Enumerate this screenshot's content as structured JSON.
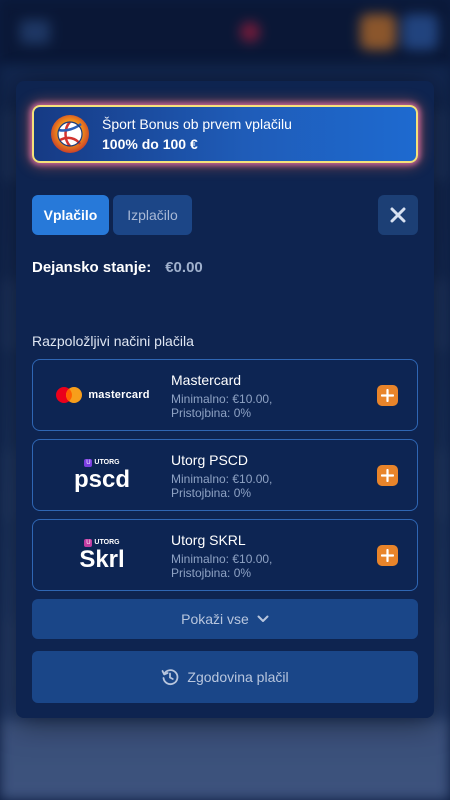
{
  "bonus": {
    "title": "Šport Bonus ob prvem vplačilu",
    "amount": "100% do 100 €",
    "icon": "volleyball-icon"
  },
  "tabs": [
    {
      "label": "Vplačilo",
      "active": true
    },
    {
      "label": "Izplačilo",
      "active": false
    }
  ],
  "close_icon": "close-icon",
  "balance": {
    "label": "Dejansko stanje:",
    "value": "€0.00"
  },
  "methods_title": "Razpoložljivi načini plačila",
  "methods": [
    {
      "name": "Mastercard",
      "min": "Minimalno: €10.00,",
      "fee": "Pristojbina: 0%",
      "logo_text": "mastercard",
      "icon": "mastercard-logo"
    },
    {
      "name": "Utorg PSCD",
      "min": "Minimalno: €10.00,",
      "fee": "Pristojbina: 0%",
      "logo_badge": "UTORG",
      "logo_text": "pscd",
      "icon": "utorg-pscd-logo"
    },
    {
      "name": "Utorg SKRL",
      "min": "Minimalno: €10.00,",
      "fee": "Pristojbina: 0%",
      "logo_badge": "UTORG",
      "logo_text": "Skrl",
      "icon": "utorg-skrl-logo"
    }
  ],
  "show_all": {
    "label": "Pokaži vse",
    "icon": "chevron-down-icon"
  },
  "history": {
    "label": "Zgodovina plačil",
    "icon": "history-icon"
  },
  "colors": {
    "panel": "#0e2450",
    "accent": "#2779d9",
    "plus": "#e8842a",
    "bonus_border": "#f5e27a"
  }
}
